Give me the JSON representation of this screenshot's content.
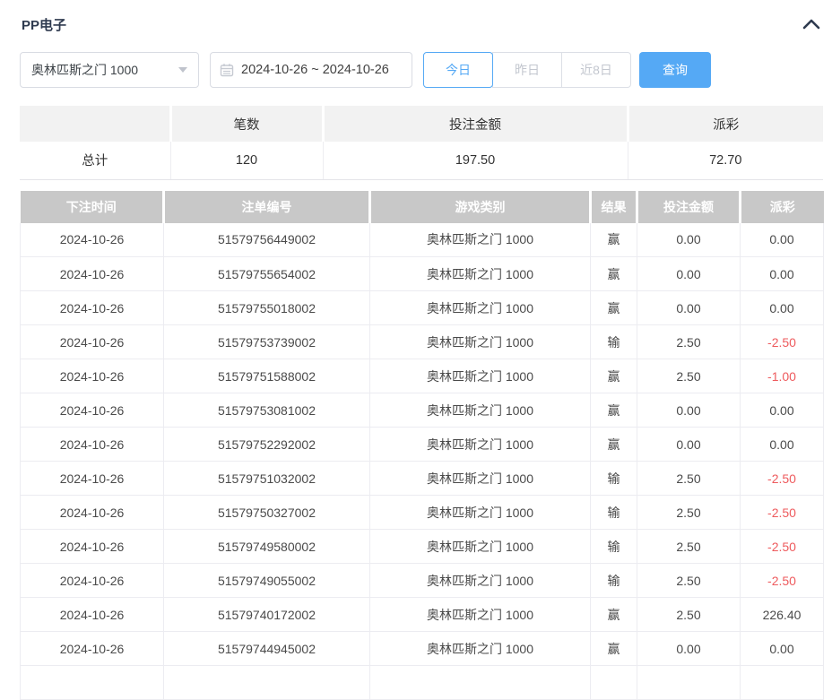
{
  "colors": {
    "accent": "#55a9f5",
    "negative": "#ee5b5e",
    "table_header_bg": "#c8c8c8",
    "summary_header_bg": "#f2f2f2"
  },
  "panel": {
    "title": "PP电子",
    "collapse_icon": "chevron-up"
  },
  "controls": {
    "game_select": {
      "value": "奥林匹斯之门 1000",
      "icon": "chevron-down"
    },
    "date_range": {
      "value": "2024-10-26 ~ 2024-10-26",
      "icon": "calendar"
    },
    "quick_ranges": [
      {
        "label": "今日",
        "active": true
      },
      {
        "label": "昨日",
        "active": false
      },
      {
        "label": "近8日",
        "active": false
      }
    ],
    "query_button": "查询"
  },
  "summary": {
    "headers": [
      "",
      "笔数",
      "投注金额",
      "派彩"
    ],
    "total_label": "总计",
    "count": "120",
    "bet_amount": "197.50",
    "payout": "72.70"
  },
  "table": {
    "headers": [
      "下注时间",
      "注单编号",
      "游戏类别",
      "结果",
      "投注金额",
      "派彩"
    ],
    "rows": [
      [
        "2024-10-26",
        "51579756449002",
        "奥林匹斯之门 1000",
        "赢",
        "0.00",
        "0.00"
      ],
      [
        "2024-10-26",
        "51579755654002",
        "奥林匹斯之门 1000",
        "赢",
        "0.00",
        "0.00"
      ],
      [
        "2024-10-26",
        "51579755018002",
        "奥林匹斯之门 1000",
        "赢",
        "0.00",
        "0.00"
      ],
      [
        "2024-10-26",
        "51579753739002",
        "奥林匹斯之门 1000",
        "输",
        "2.50",
        "-2.50"
      ],
      [
        "2024-10-26",
        "51579751588002",
        "奥林匹斯之门 1000",
        "赢",
        "2.50",
        "-1.00"
      ],
      [
        "2024-10-26",
        "51579753081002",
        "奥林匹斯之门 1000",
        "赢",
        "0.00",
        "0.00"
      ],
      [
        "2024-10-26",
        "51579752292002",
        "奥林匹斯之门 1000",
        "赢",
        "0.00",
        "0.00"
      ],
      [
        "2024-10-26",
        "51579751032002",
        "奥林匹斯之门 1000",
        "输",
        "2.50",
        "-2.50"
      ],
      [
        "2024-10-26",
        "51579750327002",
        "奥林匹斯之门 1000",
        "输",
        "2.50",
        "-2.50"
      ],
      [
        "2024-10-26",
        "51579749580002",
        "奥林匹斯之门 1000",
        "输",
        "2.50",
        "-2.50"
      ],
      [
        "2024-10-26",
        "51579749055002",
        "奥林匹斯之门 1000",
        "输",
        "2.50",
        "-2.50"
      ],
      [
        "2024-10-26",
        "51579740172002",
        "奥林匹斯之门 1000",
        "赢",
        "2.50",
        "226.40"
      ],
      [
        "2024-10-26",
        "51579744945002",
        "奥林匹斯之门 1000",
        "赢",
        "0.00",
        "0.00"
      ]
    ],
    "partial_row_visible": true
  }
}
